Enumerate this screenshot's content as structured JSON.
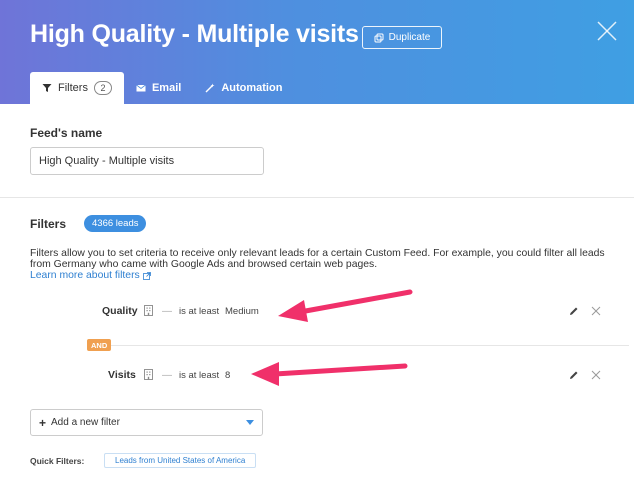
{
  "header": {
    "title": "High Quality - Multiple visits",
    "duplicate_label": "Duplicate",
    "tabs": [
      {
        "label": "Filters",
        "count": "2",
        "icon": "filter-icon",
        "active": true
      },
      {
        "label": "Email",
        "icon": "email-icon",
        "active": false
      },
      {
        "label": "Automation",
        "icon": "magic-wand-icon",
        "active": false
      }
    ]
  },
  "feed": {
    "name_label": "Feed's name",
    "name_value": "High Quality - Multiple visits"
  },
  "filters": {
    "heading": "Filters",
    "leads_badge": "4366 leads",
    "description": "Filters allow you to set criteria to receive only relevant leads for a certain Custom Feed. For example, you could filter all leads from Germany who came with Google Ads and browsed certain web pages.",
    "learn_more": "Learn more about filters",
    "rows": [
      {
        "name": "Quality",
        "dash": "—",
        "condition": "is at least",
        "value": "Medium"
      },
      {
        "name": "Visits",
        "dash": "—",
        "condition": "is at least",
        "value": "8"
      }
    ],
    "joiner": "AND",
    "add_filter_label": "Add a new filter",
    "quick_filters_label": "Quick Filters:",
    "quick_filters": [
      "Leads from United States of America"
    ]
  },
  "colors": {
    "header_gradient_start": "#6f74d8",
    "header_gradient_end": "#3f9fe3",
    "accent_blue": "#3d8fe0",
    "and_badge": "#f0a050",
    "annotation_arrow": "#f0306a"
  }
}
